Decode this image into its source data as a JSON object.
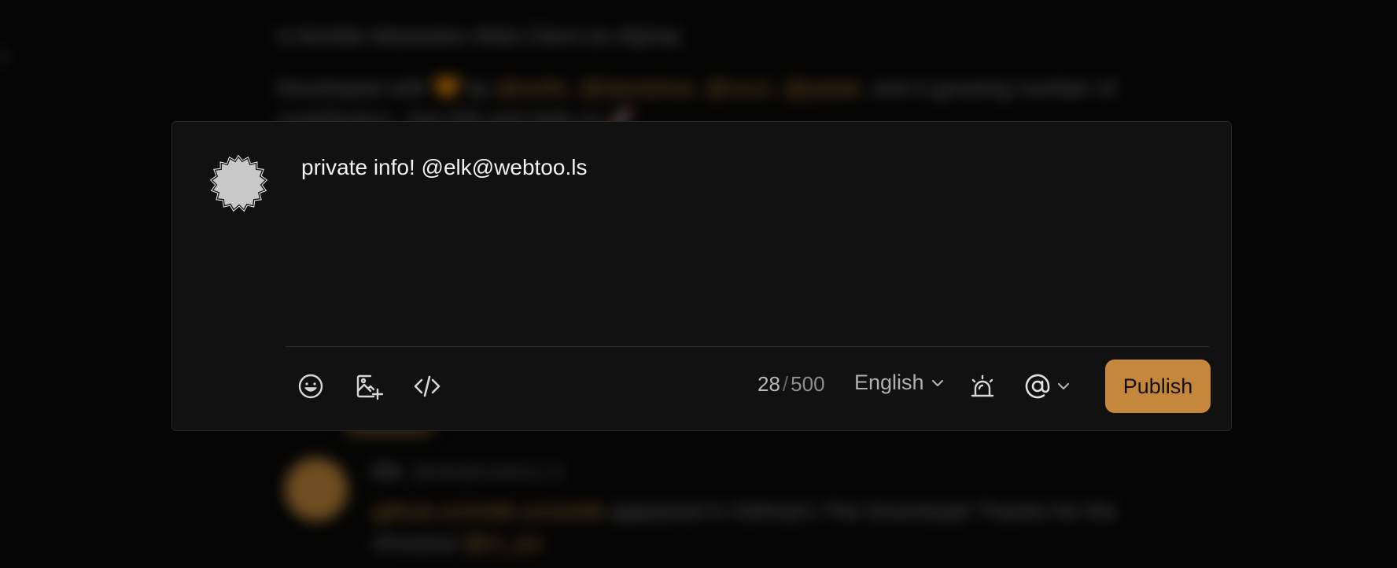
{
  "background": {
    "title": "A Nimble Mastodon Web Client (in Alpha)",
    "description_prefix": "Developed with 🧡 by",
    "description_links": "@antfu, @danielroe, @sxzz, @patak",
    "description_suffix": ", and a growing number of contributors. Join Elk and help us 🚀",
    "post_author": "Elk",
    "post_handle": "@elk@webtoo.ls",
    "post_link": "github.com/elk-zone/elk",
    "post_text": " appeared in GitHub's The Download! Thanks for the shoutout",
    "post_mention": "@rz_jsx"
  },
  "composer": {
    "text": "private info! @elk@webtoo.ls",
    "char_count": "28",
    "char_separator": "/",
    "char_limit": "500",
    "language": "English",
    "publish_label": "Publish"
  },
  "icons": {
    "emoji": "emoji-icon",
    "add_image": "add-image-icon",
    "code": "code-icon",
    "sensitive": "alarm-icon",
    "visibility": "at-sign-icon"
  },
  "colors": {
    "accent": "#c4873c",
    "modal_bg": "#111111",
    "page_bg": "#050505"
  }
}
